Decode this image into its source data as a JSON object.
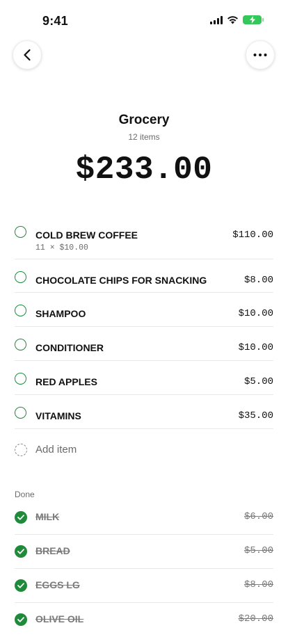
{
  "status_bar": {
    "time": "9:41"
  },
  "header": {
    "title": "Grocery",
    "count_label": "12 items"
  },
  "total": "$233.00",
  "items": [
    {
      "name": "COLD BREW COFFEE",
      "price": "$110.00",
      "detail": "11 × $10.00"
    },
    {
      "name": "CHOCOLATE CHIPS FOR SNACKING",
      "price": "$8.00"
    },
    {
      "name": "SHAMPOO",
      "price": "$10.00"
    },
    {
      "name": "CONDITIONER",
      "price": "$10.00"
    },
    {
      "name": "RED APPLES",
      "price": "$5.00"
    },
    {
      "name": "VITAMINS",
      "price": "$35.00"
    }
  ],
  "add_item_label": "Add item",
  "done_section": {
    "label": "Done",
    "items": [
      {
        "name": "MILK",
        "price": "$6.00"
      },
      {
        "name": "BREAD",
        "price": "$5.00"
      },
      {
        "name": "EGGS LG",
        "price": "$8.00"
      },
      {
        "name": "OLIVE OIL",
        "price": "$20.00"
      }
    ]
  },
  "colors": {
    "accent_green": "#1f8a3a",
    "battery_green": "#34c759"
  },
  "icons": {
    "back": "chevron-left-icon",
    "more": "ellipsis-icon",
    "signal": "cellular-signal-icon",
    "wifi": "wifi-icon",
    "battery": "battery-charging-icon",
    "unchecked": "empty-circle-icon",
    "checked": "checkmark-circle-icon",
    "add": "dashed-circle-icon"
  }
}
